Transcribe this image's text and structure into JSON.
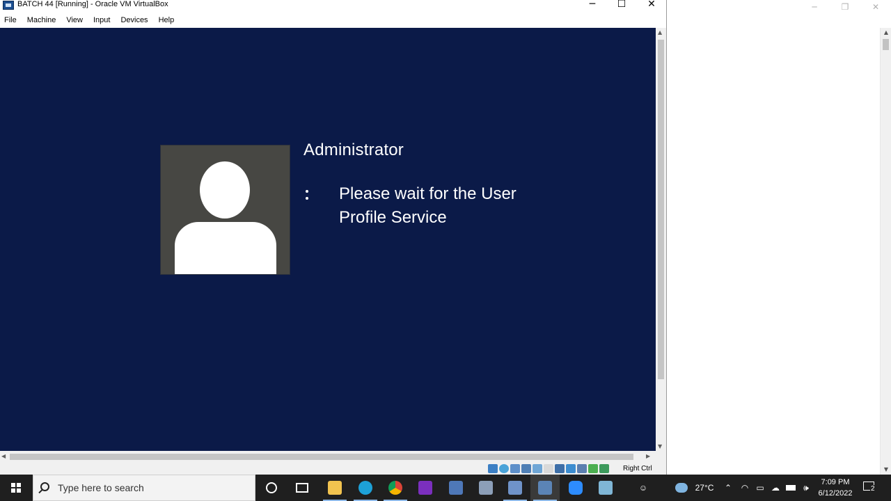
{
  "window": {
    "title": "BATCH 44 [Running] - Oracle VM VirtualBox",
    "minimize_glyph": "─",
    "maximize_glyph": "☐",
    "close_glyph": "✕"
  },
  "menu": [
    "File",
    "Machine",
    "View",
    "Input",
    "Devices",
    "Help"
  ],
  "vm": {
    "username": "Administrator",
    "status_line1": "Please wait for the User",
    "status_line2": "Profile Service",
    "background_color": "#0b1a48"
  },
  "statusbar": {
    "host_key": "Right Ctrl",
    "icons": [
      "hard-disk-icon",
      "optical-drive-icon",
      "audio-icon",
      "network-icon",
      "usb-icon",
      "shared-folders-icon",
      "display-icon",
      "video-capture-icon",
      "cpu-icon",
      "mouse-integration-icon",
      "keyboard-icon"
    ]
  },
  "bg_window": {
    "minimize_glyph": "─",
    "restore_glyph": "❐",
    "close_glyph": "✕"
  },
  "taskbar": {
    "search_placeholder": "Type here to search",
    "apps": [
      "cortana-icon",
      "task-view-icon",
      "file-explorer-icon",
      "edge-icon",
      "chrome-icon",
      "onenote-icon",
      "remote-desktop-icon",
      "network-tool-icon",
      "virtualbox-icon",
      "server-manager-icon",
      "zoom-icon",
      "notepad-icon"
    ],
    "weather": "27°C",
    "time": "7:09 PM",
    "date": "6/12/2022",
    "notification_count": "2"
  },
  "colors": {
    "taskbar": "#1f1f1f",
    "vm_screen": "#0b1a48",
    "avatar_bg": "#474743"
  }
}
